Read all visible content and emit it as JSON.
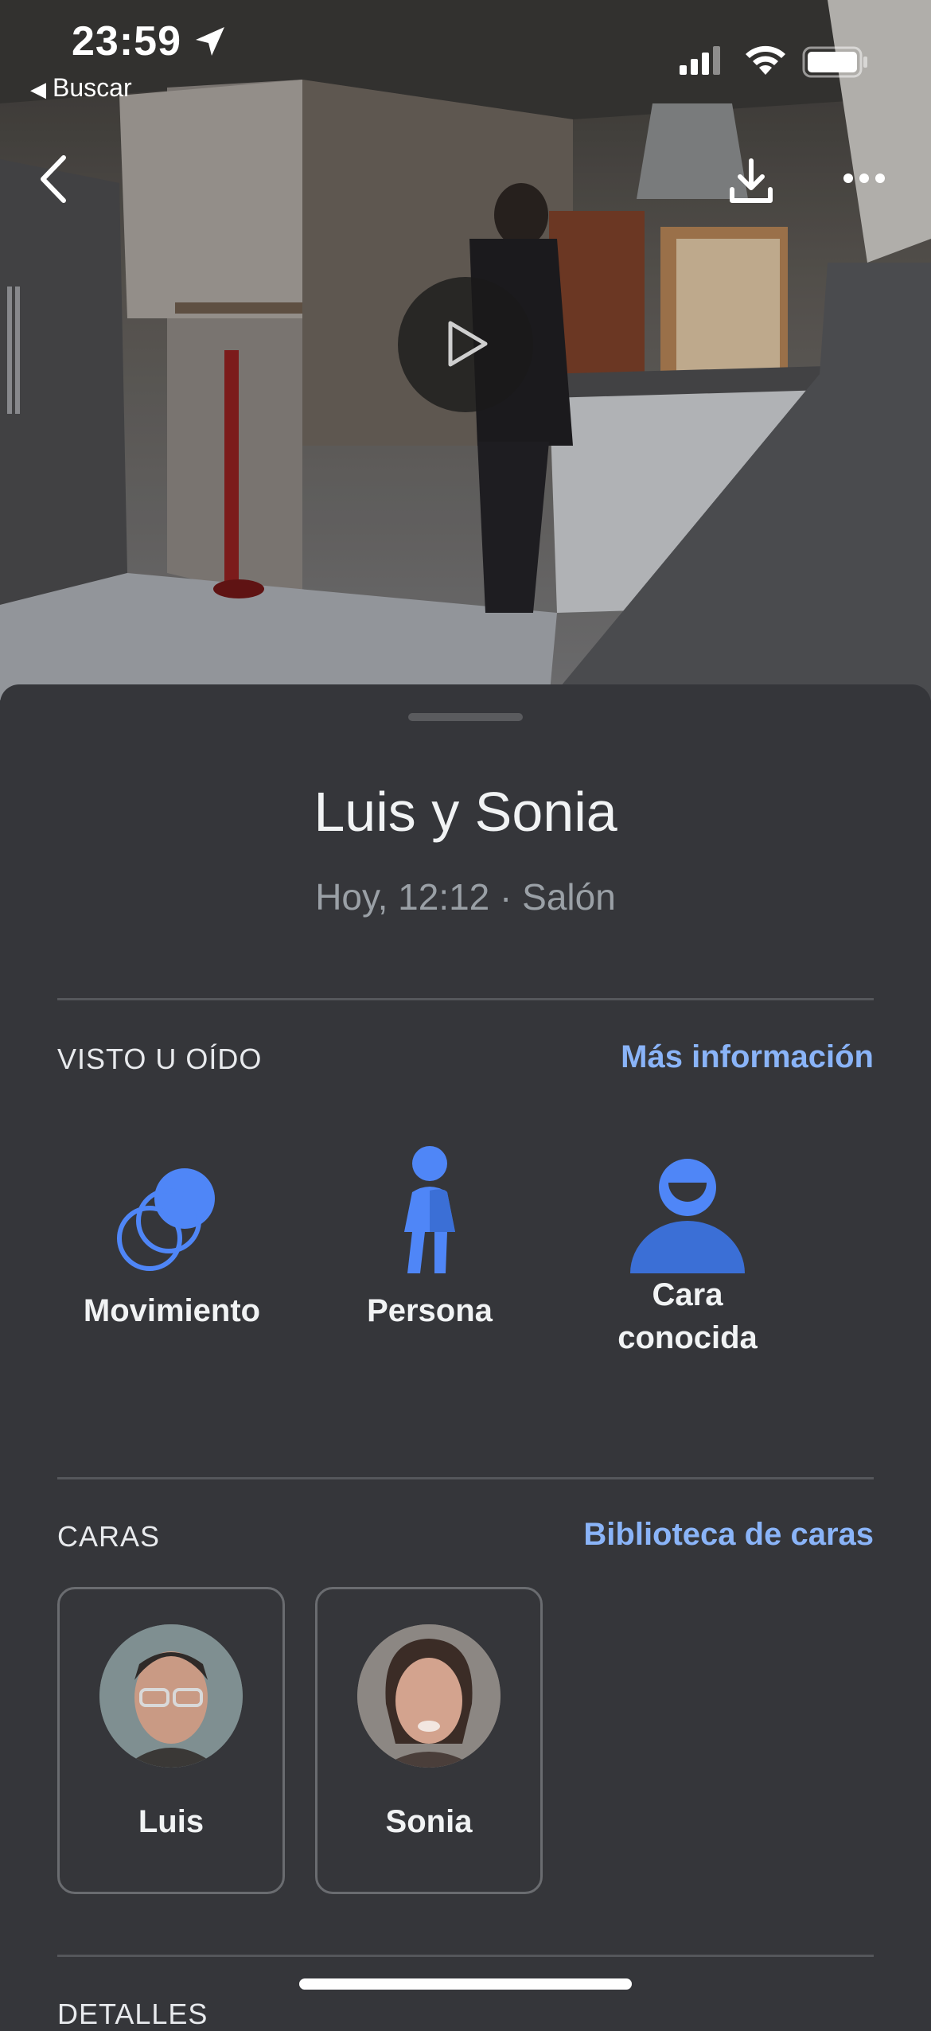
{
  "status_bar": {
    "time": "23:59",
    "back_app_label": "Buscar"
  },
  "video": {
    "play_icon": "play-icon",
    "back_icon": "chevron-left-icon",
    "download_icon": "download-icon",
    "more_icon": "more-horizontal-icon"
  },
  "event": {
    "title": "Luis y Sonia",
    "subtitle": "Hoy, 12:12 · Salón"
  },
  "seen_heard": {
    "label": "VISTO U OÍDO",
    "link": "Más información",
    "items": [
      {
        "label": "Movimiento",
        "icon": "motion-icon"
      },
      {
        "label": "Persona",
        "icon": "person-icon"
      },
      {
        "label_line1": "Cara",
        "label_line2": "conocida",
        "icon": "familiar-face-icon"
      }
    ]
  },
  "faces": {
    "label": "CARAS",
    "link": "Biblioteca de caras",
    "items": [
      {
        "name": "Luis"
      },
      {
        "name": "Sonia"
      }
    ]
  },
  "details": {
    "label": "DETALLES"
  },
  "colors": {
    "background": "#35363a",
    "accent": "#8ab4f8",
    "icon_blue": "#4f86f7"
  }
}
